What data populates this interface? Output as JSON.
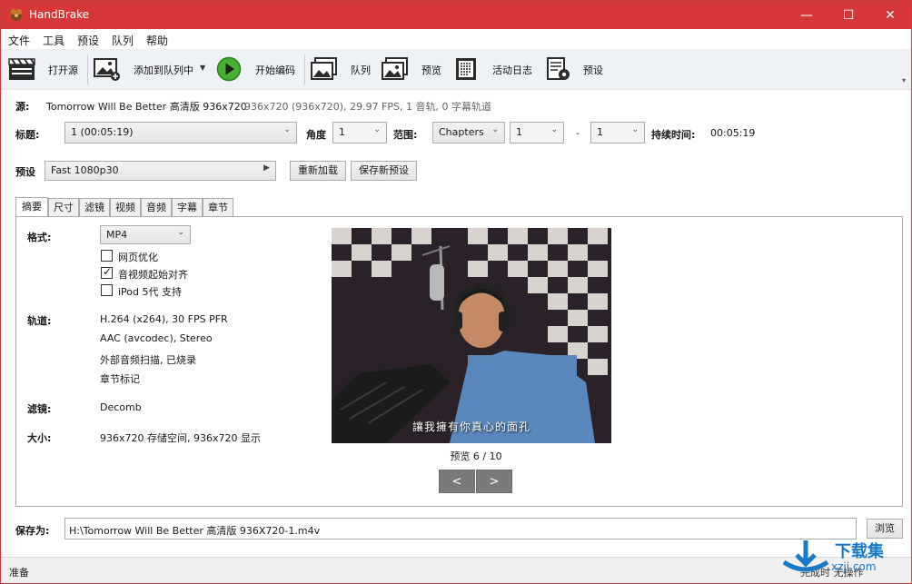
{
  "window": {
    "title": "HandBrake",
    "accent_color": "#d6383a",
    "min_glyph": "—",
    "max_glyph": "☐",
    "close_glyph": "✕"
  },
  "menu": [
    "文件",
    "工具",
    "预设",
    "队列",
    "帮助"
  ],
  "toolbar": {
    "open_source": "打开源",
    "add_to_queue": "添加到队列中",
    "start_encode": "开始编码",
    "queue": "队列",
    "preview": "预览",
    "activity_log": "活动日志",
    "presets": "预设"
  },
  "source": {
    "label": "源:",
    "name": "Tomorrow Will Be Better 高清版 936x720",
    "info": "936x720 (936x720), 29.97 FPS, 1 音轨, 0 字幕轨道"
  },
  "title_row": {
    "title_label": "标题:",
    "title_value": "1 (00:05:19)",
    "angle_label": "角度",
    "angle_value": "1",
    "range_label": "范围:",
    "range_type": "Chapters",
    "range_start": "1",
    "range_dash": "-",
    "range_end": "1",
    "duration_label": "持续时间:",
    "duration_value": "00:05:19"
  },
  "preset_row": {
    "label": "预设",
    "value": "Fast 1080p30",
    "reload": "重新加载",
    "save_new": "保存新预设"
  },
  "tabs": [
    "摘要",
    "尺寸",
    "滤镜",
    "视频",
    "音频",
    "字幕",
    "章节"
  ],
  "summary": {
    "format_label": "格式:",
    "format_value": "MP4",
    "web_optimized": "网页优化",
    "align_av": "音视频起始对齐",
    "ipod": "iPod 5代 支持",
    "web_optimized_checked": false,
    "align_av_checked": true,
    "ipod_checked": false,
    "tracks_label": "轨道:",
    "tracks": [
      "H.264 (x264), 30 FPS PFR",
      "AAC (avcodec), Stereo",
      "外部音频扫描, 已烧录",
      "章节标记"
    ],
    "filters_label": "滤镜:",
    "filters_value": "Decomb",
    "size_label": "大小:",
    "size_value": "936x720 存储空间, 936x720 显示"
  },
  "preview": {
    "caption": "讓我擁有你真心的面孔",
    "counter": "预览 6 / 10",
    "prev": "<",
    "next": ">"
  },
  "save": {
    "label": "保存为:",
    "path": "H:\\Tomorrow Will Be Better 高清版 936X720-1.m4v",
    "browse": "浏览"
  },
  "status": {
    "left": "准备",
    "right": "完成时   无操作"
  },
  "watermark": {
    "main": "下载集",
    "sub": "xzji.com"
  }
}
